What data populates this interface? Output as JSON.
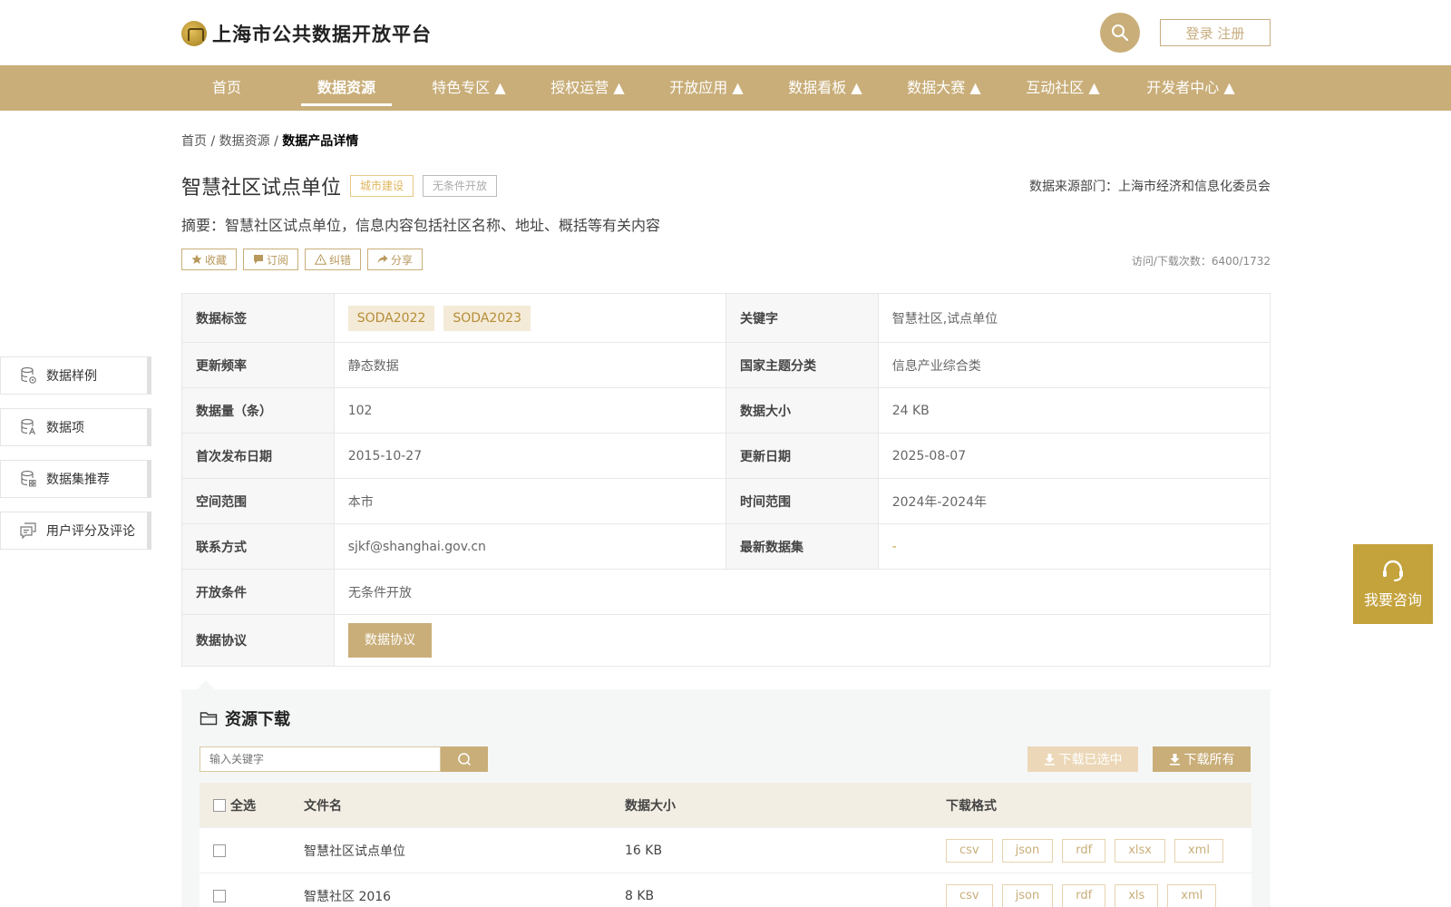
{
  "header": {
    "site_title": "上海市公共数据开放平台",
    "login_label": "登录 注册",
    "search_icon": "search-icon"
  },
  "nav": {
    "items": [
      {
        "label": "首页"
      },
      {
        "label": "数据资源"
      },
      {
        "label": "特色专区 ▲"
      },
      {
        "label": "授权运营 ▲"
      },
      {
        "label": "开放应用 ▲"
      },
      {
        "label": "数据看板 ▲"
      },
      {
        "label": "数据大赛 ▲"
      },
      {
        "label": "互动社区 ▲"
      },
      {
        "label": "开发者中心 ▲"
      }
    ],
    "active_index": 1
  },
  "breadcrumb": {
    "home": "首页",
    "sep": " / ",
    "resources": "数据资源",
    "current": "数据产品详情"
  },
  "product": {
    "title": "智慧社区试点单位",
    "tag_category": "城市建设",
    "tag_open": "无条件开放",
    "source": "数据来源部门：上海市经济和信息化委员会",
    "summary": "摘要：智慧社区试点单位，信息内容包括社区名称、地址、概括等有关内容",
    "visits": "访问/下载次数：6400/1732"
  },
  "actions": {
    "favorite": "收藏",
    "subscribe": "订阅",
    "report": "纠错",
    "share": "分享"
  },
  "info": {
    "tags_label": "数据标签",
    "tags": [
      "SODA2022",
      "SODA2023"
    ],
    "keywords_label": "关键字",
    "keywords": "智慧社区,试点单位",
    "freq_label": "更新频率",
    "freq": "静态数据",
    "theme_label": "国家主题分类",
    "theme": "信息产业综合类",
    "count_label": "数据量（条）",
    "count": "102",
    "size_label": "数据大小",
    "size": "24 KB",
    "first_label": "首次发布日期",
    "first": "2015-10-27",
    "update_label": "更新日期",
    "update": "2025-08-07",
    "space_label": "空间范围",
    "space": "本市",
    "time_label": "时间范围",
    "time": "2024年-2024年",
    "contact_label": "联系方式",
    "contact": "sjkf@shanghai.gov.cn",
    "latest_label": "最新数据集",
    "latest": "-",
    "cond_label": "开放条件",
    "cond": "无条件开放",
    "protocol_label": "数据协议",
    "protocol_btn": "数据协议"
  },
  "sidebar": {
    "items": [
      {
        "label": "数据样例",
        "icon": "database-icon"
      },
      {
        "label": "数据项",
        "icon": "database-text-icon"
      },
      {
        "label": "数据集推荐",
        "icon": "database-grid-icon"
      },
      {
        "label": "用户评分及评论",
        "icon": "comment-icon"
      }
    ]
  },
  "consult": {
    "label": "我要咨询",
    "icon": "headset-icon"
  },
  "resources": {
    "title": "资源下载",
    "search_placeholder": "输入关键字",
    "download_selected": "下载已选中",
    "download_all": "下载所有",
    "columns": {
      "select_all": "全选",
      "filename": "文件名",
      "size": "数据大小",
      "formats": "下载格式"
    },
    "files": [
      {
        "name": "智慧社区试点单位",
        "size": "16 KB",
        "formats": [
          "csv",
          "json",
          "rdf",
          "xlsx",
          "xml"
        ]
      },
      {
        "name": "智慧社区 2016",
        "size": "8 KB",
        "formats": [
          "csv",
          "json",
          "rdf",
          "xls",
          "xml"
        ]
      }
    ]
  },
  "colors": {
    "brand_gold": "#c9ae79",
    "consult_gold": "#c4a23c",
    "chip_bg": "#f4ead8"
  }
}
